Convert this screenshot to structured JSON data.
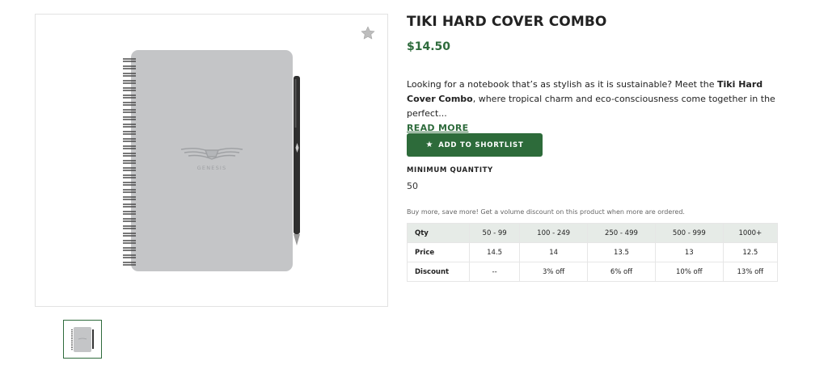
{
  "product": {
    "title": "TIKI HARD COVER COMBO",
    "price": "$14.50",
    "description_intro": "Looking for a notebook that’s as stylish as it is sustainable? Meet the ",
    "description_bold_1": "Tiki Hard Cover",
    "description_bold_2": "Combo",
    "description_rest": ", where tropical charm and eco-consciousness come together in the perfect...",
    "read_more": "READ MORE",
    "image_logo_text": "GENESIS"
  },
  "actions": {
    "add_to_shortlist": "ADD TO SHORTLIST"
  },
  "minimum_quantity": {
    "label": "MINIMUM QUANTITY",
    "value": "50"
  },
  "volume_note": "Buy more, save more! Get a volume discount on this product when more are ordered.",
  "pricing_table": {
    "headers": [
      "Qty",
      "50 - 99",
      "100 - 249",
      "250 - 499",
      "500 - 999",
      "1000+"
    ],
    "rows": [
      [
        "Price",
        "14.5",
        "14",
        "13.5",
        "13",
        "12.5"
      ],
      [
        "Discount",
        "--",
        "3% off",
        "6% off",
        "10% off",
        "13% off"
      ]
    ]
  },
  "colors": {
    "brand_green": "#2d6b3a",
    "table_header_bg": "#e6ebe7",
    "notebook_cover": "#c4c5c7"
  },
  "icons": {
    "favorite": "star-icon",
    "shortlist": "star-icon"
  }
}
